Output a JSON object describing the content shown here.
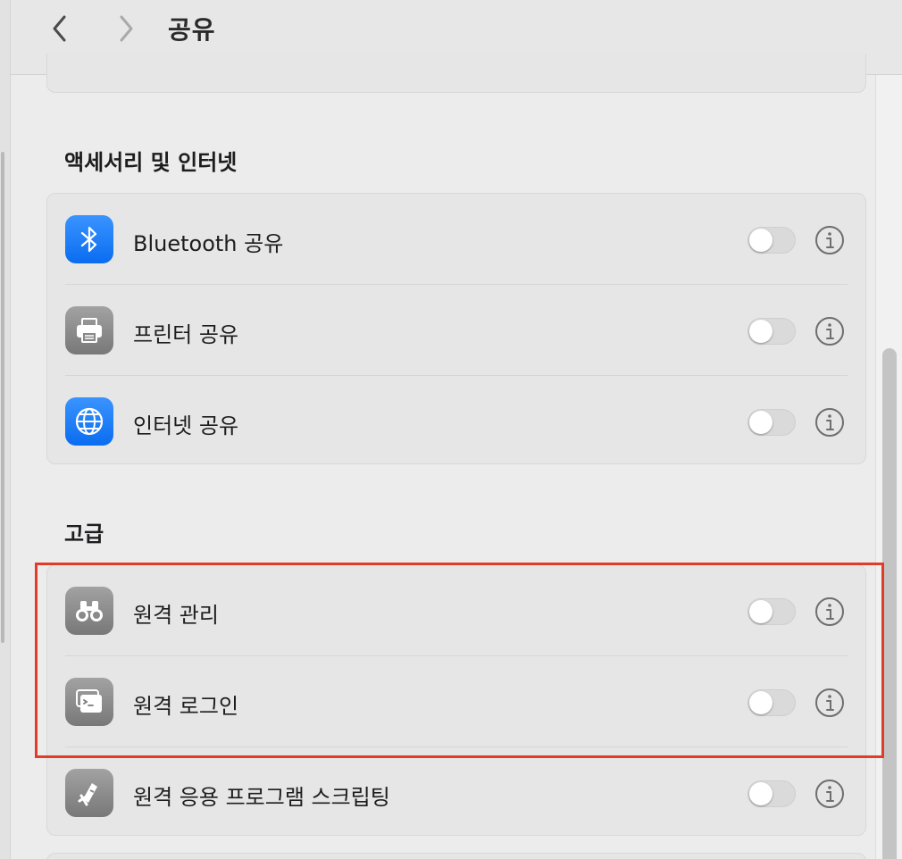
{
  "toolbar": {
    "title": "공유",
    "back_icon": "chevron-left-icon",
    "forward_icon": "chevron-right-icon"
  },
  "sections": [
    {
      "title": "액세서리 및 인터넷",
      "items": [
        {
          "label": "Bluetooth 공유",
          "icon": "bluetooth-icon",
          "icon_color": "#1877f2",
          "enabled": false
        },
        {
          "label": "프린터 공유",
          "icon": "printer-icon",
          "icon_color": "#8e8e93",
          "enabled": false
        },
        {
          "label": "인터넷 공유",
          "icon": "globe-icon",
          "icon_color": "#1877f2",
          "enabled": false
        }
      ]
    },
    {
      "title": "고급",
      "items": [
        {
          "label": "원격 관리",
          "icon": "binoculars-icon",
          "icon_color": "#8e8e93",
          "enabled": false
        },
        {
          "label": "원격 로그인",
          "icon": "terminal-icon",
          "icon_color": "#8e8e93",
          "enabled": false
        },
        {
          "label": "원격 응용 프로그램 스크립팅",
          "icon": "script-icon",
          "icon_color": "#8e8e93",
          "enabled": false
        }
      ]
    }
  ],
  "highlight_color": "#e03c28"
}
